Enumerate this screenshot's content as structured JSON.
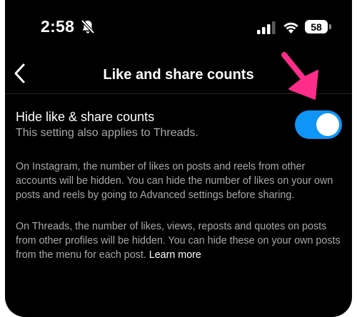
{
  "status_bar": {
    "time": "2:58",
    "battery_level": "58",
    "icons": [
      "bell-slash-icon",
      "cellular-signal-icon",
      "wifi-icon",
      "battery-icon"
    ]
  },
  "header": {
    "title": "Like and share counts",
    "back_icon": "chevron-left-icon"
  },
  "setting": {
    "label": "Hide like & share counts",
    "description": "This setting also applies to Threads.",
    "toggle_on": true
  },
  "info": {
    "instagram_paragraph": "On Instagram, the number of likes on posts and reels from other accounts will be hidden. You can hide the number of likes on your own posts and reels by going to Advanced settings before sharing.",
    "threads_paragraph": "On Threads, the number of likes, views, reposts and quotes on posts from other profiles will be hidden. You can hide these on your own posts from the menu for each post.",
    "learn_more": "Learn more"
  },
  "colors": {
    "background": "#000000",
    "toggle_on": "#0f95f6",
    "secondary_text": "#a8a8a8",
    "annotation_arrow": "#ff2d8a"
  }
}
